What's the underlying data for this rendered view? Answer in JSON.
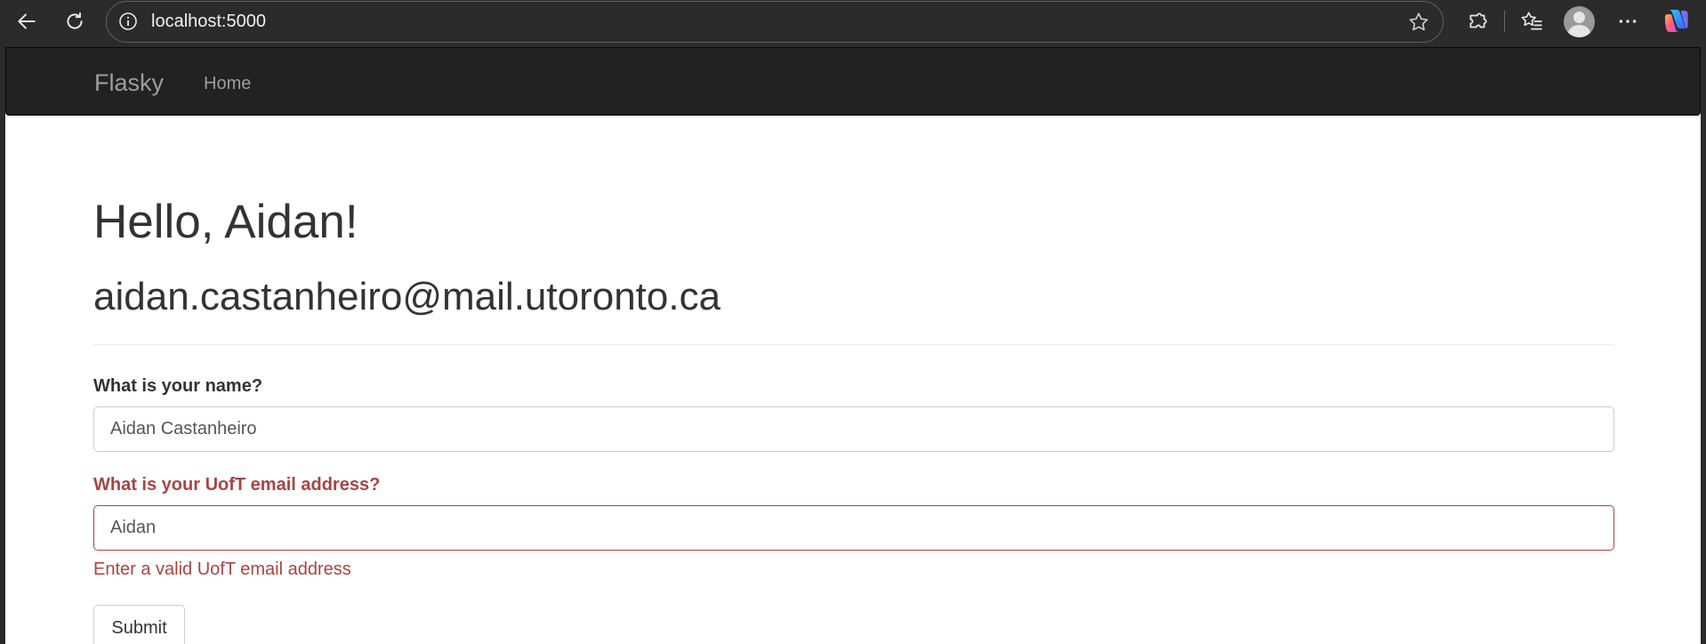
{
  "browser": {
    "url": "localhost:5000",
    "icons": {
      "back": "back-arrow-icon",
      "reload": "reload-icon",
      "site_info": "info-icon",
      "favorite": "star-icon",
      "extensions": "puzzle-icon",
      "favorites": "favorites-icon",
      "profile": "avatar",
      "more": "more-icon",
      "copilot": "copilot-icon"
    }
  },
  "navbar": {
    "brand": "Flasky",
    "links": [
      {
        "label": "Home"
      }
    ]
  },
  "page": {
    "greeting": "Hello, Aidan!",
    "email": "aidan.castanheiro@mail.utoronto.ca"
  },
  "form": {
    "name_label": "What is your name?",
    "name_value": "Aidan Castanheiro",
    "email_label": "What is your UofT email address?",
    "email_value": "Aidan",
    "email_error": "Enter a valid UofT email address",
    "submit_label": "Submit"
  },
  "colors": {
    "navbar_bg": "#222222",
    "error": "#a94442",
    "text": "#333333"
  }
}
